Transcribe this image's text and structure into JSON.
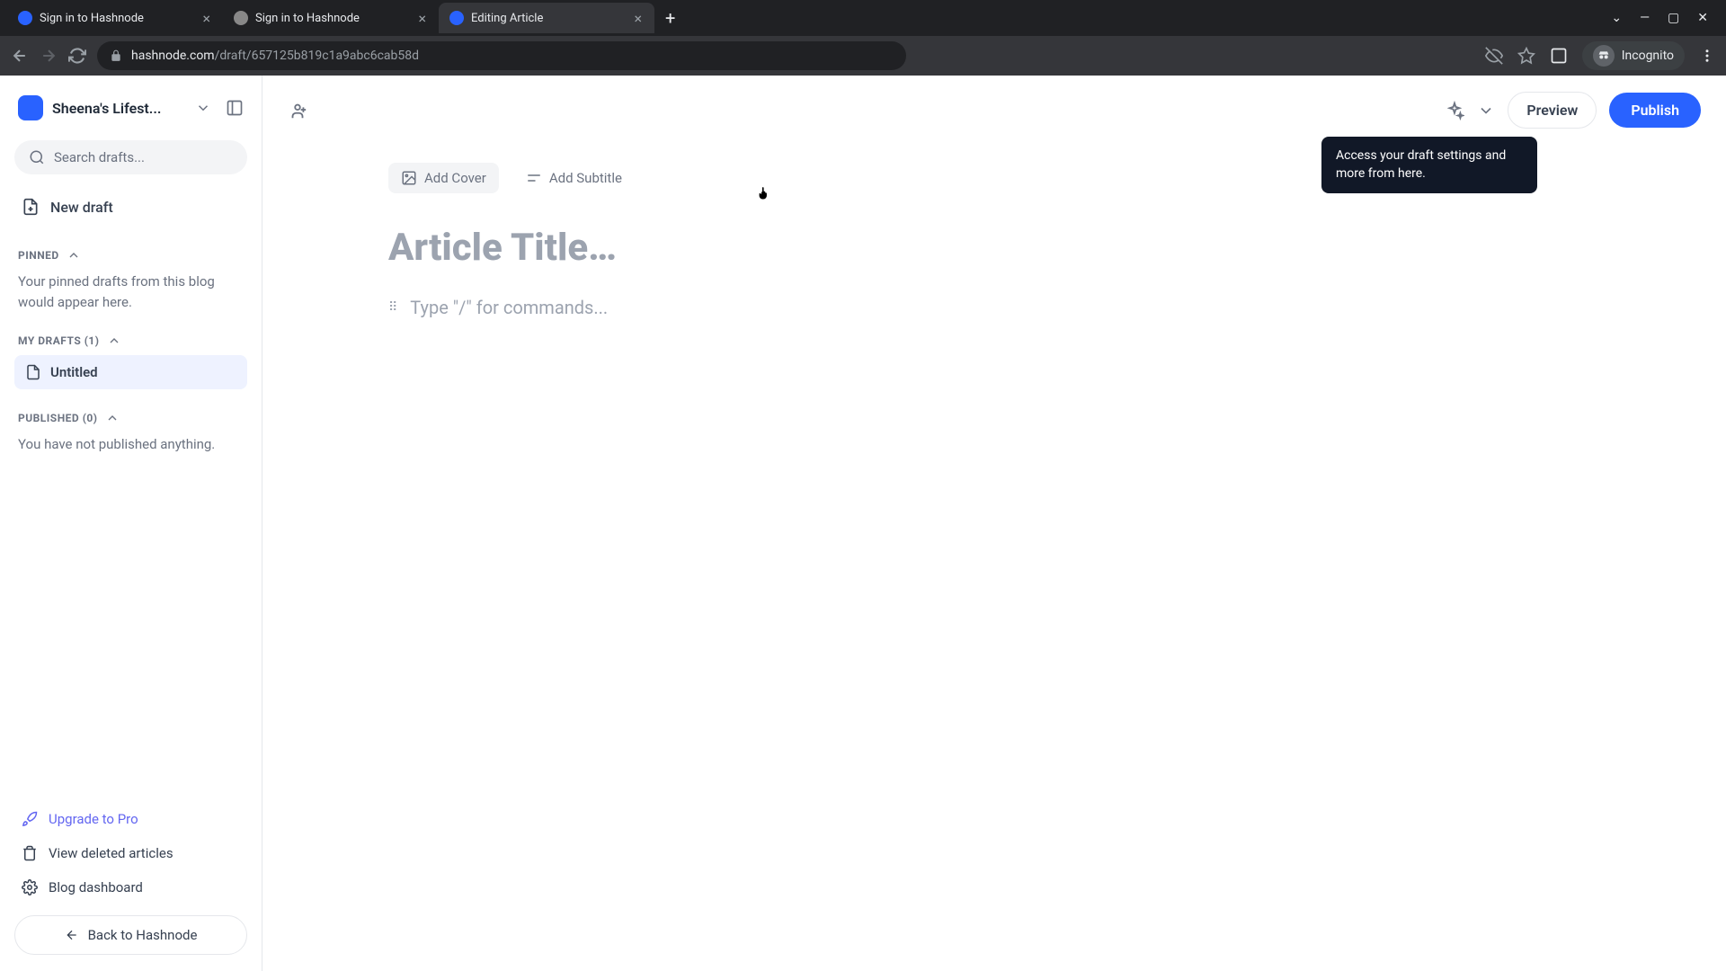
{
  "browser": {
    "tabs": [
      {
        "title": "Sign in to Hashnode",
        "favicon": "hashnode"
      },
      {
        "title": "Sign in to Hashnode",
        "favicon": "gray"
      },
      {
        "title": "Editing Article",
        "favicon": "hashnode"
      }
    ],
    "url_host": "hashnode.com",
    "url_path": "/draft/657125b819c1a9abc6cab58d",
    "incognito_label": "Incognito"
  },
  "sidebar": {
    "blog_name": "Sheena's Lifest...",
    "search_placeholder": "Search drafts...",
    "new_draft_label": "New draft",
    "pinned": {
      "header": "PINNED",
      "empty_text": "Your pinned drafts from this blog would appear here."
    },
    "my_drafts": {
      "header": "MY DRAFTS (1)",
      "items": [
        {
          "title": "Untitled"
        }
      ]
    },
    "published": {
      "header": "PUBLISHED (0)",
      "empty_text": "You have not published anything."
    },
    "footer": {
      "upgrade": "Upgrade to Pro",
      "deleted": "View deleted articles",
      "dashboard": "Blog dashboard",
      "back": "Back to Hashnode"
    }
  },
  "editor": {
    "add_cover_label": "Add Cover",
    "add_subtitle_label": "Add Subtitle",
    "title_placeholder": "Article Title…",
    "content_placeholder": "Type \"/\" for commands...",
    "preview_label": "Preview",
    "publish_label": "Publish",
    "tooltip_text": "Access your draft settings and more from here."
  }
}
